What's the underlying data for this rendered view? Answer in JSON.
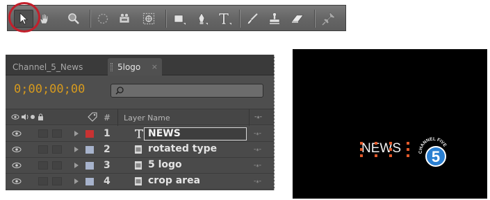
{
  "toolbar": {
    "tools": [
      {
        "name": "selection-tool",
        "icon": "arrow-cursor-icon",
        "active": true
      },
      {
        "name": "hand-tool",
        "icon": "hand-icon"
      },
      {
        "name": "zoom-tool",
        "icon": "magnifier-icon"
      },
      {
        "name": "rotation-tool",
        "icon": "rotate-icon"
      },
      {
        "name": "camera-tool",
        "icon": "camera-icon"
      },
      {
        "name": "pan-behind-tool",
        "icon": "pan-behind-icon"
      },
      {
        "name": "rectangle-tool",
        "icon": "rectangle-icon"
      },
      {
        "name": "pen-tool",
        "icon": "pen-icon"
      },
      {
        "name": "type-tool",
        "icon": "type-icon"
      },
      {
        "name": "brush-tool",
        "icon": "brush-icon"
      },
      {
        "name": "clone-stamp-tool",
        "icon": "clone-stamp-icon"
      },
      {
        "name": "eraser-tool",
        "icon": "eraser-icon"
      },
      {
        "name": "puppet-pin-tool",
        "icon": "pushpin-icon"
      }
    ],
    "highlight_color": "#c21f2b"
  },
  "timeline": {
    "tabs": [
      {
        "label": "Channel_5_News",
        "active": false
      },
      {
        "label": "5logo",
        "active": true
      }
    ],
    "tab_close_glyph": "×",
    "timecode": "0;00;00;00",
    "timecode_color": "#d69a1e",
    "search": {
      "value": "",
      "placeholder": ""
    },
    "columns": {
      "number": "#",
      "layer_name": "Layer Name"
    },
    "layers": [
      {
        "number": "1",
        "name": "NEWS",
        "type": "text",
        "label_color": "#c83232",
        "editing": true
      },
      {
        "number": "2",
        "name": "rotated type",
        "type": "footage",
        "label_color": "#a7b3cc"
      },
      {
        "number": "3",
        "name": "5 logo",
        "type": "footage",
        "label_color": "#a7b3cc"
      },
      {
        "number": "4",
        "name": "crop area",
        "type": "footage",
        "label_color": "#a7b3cc"
      }
    ]
  },
  "viewer": {
    "news_text": "NEWS",
    "logo_number": "5",
    "logo_arc_text": "CHANNEL FIVE",
    "handle_color": "#e25a2b"
  }
}
